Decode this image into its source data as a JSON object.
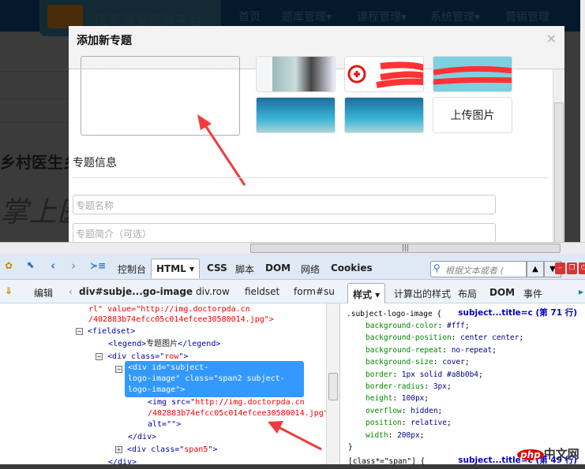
{
  "topnav": {
    "brand": "医考课堂服务平台",
    "items": [
      "首页",
      "题库管理▾",
      "课程管理▾",
      "系统管理▾",
      "营销管理"
    ]
  },
  "background": {
    "text1": "乡村医生乡",
    "text2": "掌上医"
  },
  "modal": {
    "title": "添加新专题",
    "close": "×",
    "upload_label": "上传图片",
    "legend": "专题信息",
    "name_placeholder": "专题名称",
    "desc_placeholder": "专题简介（可选）"
  },
  "devtools": {
    "tabs": [
      "控制台",
      "HTML ▾",
      "CSS",
      "脚本",
      "DOM",
      "网络",
      "Cookies"
    ],
    "search_placeholder": "根据文本或者 (",
    "edit": "编辑",
    "breadcrumb": [
      "div#subje...go-image",
      "div.row",
      "fieldset",
      "form#su"
    ],
    "side_tabs": [
      "样式 ▾",
      "计算出的样式",
      "布局",
      "DOM",
      "事件"
    ],
    "html_lines": {
      "l1a": "rl\" value=\"",
      "l1b": "http://img.doctorpda.cn",
      "l2": "/402883b74efcc05c014efcee30580014.jpg\">",
      "fieldset": "<fieldset>",
      "legend_open": "<legend>",
      "legend_text": "专题图片",
      "legend_close": "</legend>",
      "row_open": "<div class=\"",
      "row_val": "row",
      "row_close": "\">",
      "sel1": "<div id=\"subject-",
      "sel2": "logo-image\" class=\"span2 subject-",
      "sel3": "logo-image\">",
      "img1a": "<img src=\"",
      "img1b": "http://img.doctorpda.cn",
      "img2": "/402883b74efcc05c014efcee30580014.jpg\"",
      "img3": "alt=\"\">",
      "div_close": "</div>",
      "span5a": "<div class=\"",
      "span5b": "span5",
      "span5c": "\">",
      "div_close2": "</div>"
    },
    "css_rule": {
      "selector": ".subject-logo-image {",
      "source": "subject...title=c (第 71 行)",
      "props": [
        [
          "background-color",
          "#fff"
        ],
        [
          "background-position",
          "center center"
        ],
        [
          "background-repeat",
          "no-repeat"
        ],
        [
          "background-size",
          "cover"
        ],
        [
          "border",
          "1px solid #a8b0b4"
        ],
        [
          "border-radius",
          "3px"
        ],
        [
          "height",
          "100px"
        ],
        [
          "overflow",
          "hidden"
        ],
        [
          "position",
          "relative"
        ],
        [
          "width",
          "200px"
        ]
      ],
      "close": "}",
      "next_selector": "[class*=\"span\"] {",
      "next_source": "subject...title=c (第 49 行)"
    }
  },
  "watermark": {
    "a": "php",
    "b": "中文网"
  },
  "colors": {
    "selection": "#3399ff",
    "annotation_arrow": "#f03c3c"
  }
}
